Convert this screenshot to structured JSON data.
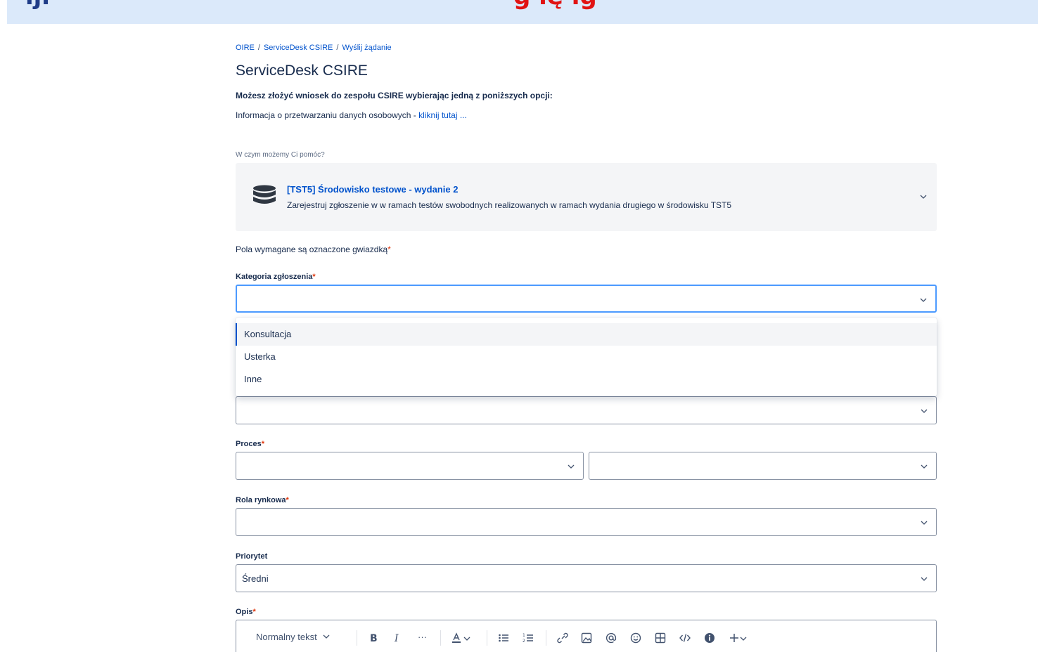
{
  "banner": {
    "left_text": "ıjı",
    "right_text": "g ıę ıg"
  },
  "breadcrumb": {
    "items": [
      "OIRE",
      "ServiceDesk CSIRE",
      "Wyślij żądanie"
    ],
    "separator": "/"
  },
  "page": {
    "title": "ServiceDesk CSIRE",
    "subtitle": "Możesz złożyć wniosek do zespołu CSIRE wybierając jedną z poniższych opcji:",
    "info_text": "Informacja o przetwarzaniu danych osobowych - ",
    "info_link": "kliknij tutaj ..."
  },
  "request_type": {
    "label": "W czym możemy Ci pomóc?",
    "title": "[TST5] Środowisko testowe - wydanie 2",
    "description": "Zarejestruj zgłoszenie w w ramach testów swobodnych realizowanych w ramach wydania drugiego w środowisku TST5",
    "icon": "database-icon"
  },
  "form": {
    "required_note": "Pola wymagane są oznaczone gwiazdką",
    "required_star": "*",
    "fields": {
      "kategoria": {
        "label": "Kategoria zgłoszenia",
        "value": ""
      },
      "proces": {
        "label": "Proces",
        "value_left": "",
        "value_right": ""
      },
      "rola": {
        "label": "Rola rynkowa",
        "value": ""
      },
      "priorytet": {
        "label": "Priorytet",
        "value": "Średni"
      },
      "opis": {
        "label": "Opis"
      }
    },
    "dropdown_options": [
      "Konsultacja",
      "Usterka",
      "Inne"
    ],
    "active_option": "Konsultacja"
  },
  "editor": {
    "text_style": "Normalny tekst",
    "more": "···"
  },
  "colors": {
    "link": "#0052cc",
    "required": "#de350b",
    "focus": "#4c9aff",
    "card_bg": "#f4f5f7",
    "banner_bg": "#dbe9fa",
    "banner_red": "#e11212",
    "banner_dark": "#1f3c88"
  }
}
